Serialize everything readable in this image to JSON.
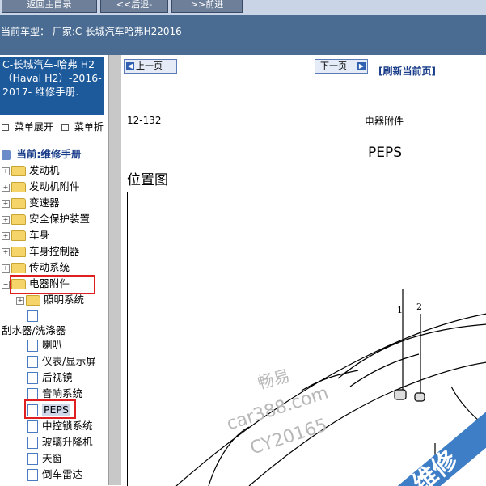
{
  "toolbar": {
    "home_label": "返回主目录",
    "back_label": "<<后退-",
    "forward_label": ">>前进"
  },
  "car_info": "当前车型：  厂家:C-长城汽车哈弗H22016",
  "sidebar": {
    "title": "C-长城汽车-哈弗 H2（Haval H2）-2016-2017- 维修手册.",
    "expand_label": "菜单展开",
    "collapse_label": "菜单折",
    "current_label": "当前:维修手册",
    "items": [
      {
        "label": "发动机"
      },
      {
        "label": "发动机附件"
      },
      {
        "label": "变速器"
      },
      {
        "label": "安全保护装置"
      },
      {
        "label": "车身"
      },
      {
        "label": "车身控制器"
      },
      {
        "label": "传动系统"
      },
      {
        "label": "电器附件"
      }
    ],
    "subitems": [
      {
        "label": "照明系统"
      },
      {
        "label": ""
      },
      {
        "label": "刮水器/洗涤器"
      },
      {
        "label": "喇叭"
      },
      {
        "label": "仪表/显示屏"
      },
      {
        "label": "后视镜"
      },
      {
        "label": "音响系统"
      },
      {
        "label": "PEPS"
      },
      {
        "label": "中控锁系统"
      },
      {
        "label": "玻璃升降机"
      },
      {
        "label": "天窗"
      },
      {
        "label": "倒车雷达"
      }
    ]
  },
  "content": {
    "prev_label": "上一页",
    "next_label": "下一页",
    "refresh_label": "[刷新当前页]",
    "page_number": "12-132",
    "section": "电器附件",
    "title": "PEPS",
    "subtitle": "位置图",
    "callouts": [
      "1",
      "2"
    ],
    "watermark_lines": [
      "畅易",
      "car388.com",
      "CY20165"
    ],
    "watermark_banner": "维修"
  }
}
